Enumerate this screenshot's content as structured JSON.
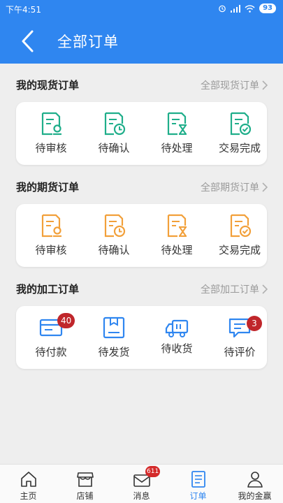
{
  "status_bar": {
    "time": "下午4:51",
    "battery": "93"
  },
  "header": {
    "title": "全部订单"
  },
  "spot": {
    "title": "我的现货订单",
    "link": "全部现货订单",
    "items": [
      {
        "label": "待审核",
        "icon": "review-icon"
      },
      {
        "label": "待确认",
        "icon": "confirm-clock-icon"
      },
      {
        "label": "待处理",
        "icon": "hourglass-icon"
      },
      {
        "label": "交易完成",
        "icon": "check-done-icon"
      }
    ]
  },
  "futures": {
    "title": "我的期货订单",
    "link": "全部期货订单",
    "items": [
      {
        "label": "待审核",
        "icon": "review-icon"
      },
      {
        "label": "待确认",
        "icon": "confirm-clock-icon"
      },
      {
        "label": "待处理",
        "icon": "hourglass-icon"
      },
      {
        "label": "交易完成",
        "icon": "check-done-icon"
      }
    ]
  },
  "processing": {
    "title": "我的加工订单",
    "link": "全部加工订单",
    "items": [
      {
        "label": "待付款",
        "badge": "40",
        "icon": "payment-icon"
      },
      {
        "label": "待发货",
        "icon": "box-icon"
      },
      {
        "label": "待收货",
        "icon": "truck-icon"
      },
      {
        "label": "待评价",
        "badge": "3",
        "icon": "comment-icon"
      }
    ]
  },
  "tabbar": {
    "items": [
      {
        "label": "主页",
        "icon": "home-icon"
      },
      {
        "label": "店铺",
        "icon": "store-icon"
      },
      {
        "label": "消息",
        "badge": "611",
        "icon": "mail-icon"
      },
      {
        "label": "订单",
        "icon": "order-icon"
      },
      {
        "label": "我的金赢",
        "icon": "user-icon"
      }
    ],
    "active": "订单"
  },
  "colors": {
    "header_blue": "#2f86f0",
    "spot_green": "#1fae8a",
    "futures_orange": "#f2a03a",
    "processing_blue": "#2f86f0",
    "badge_red": "#c0262b"
  }
}
